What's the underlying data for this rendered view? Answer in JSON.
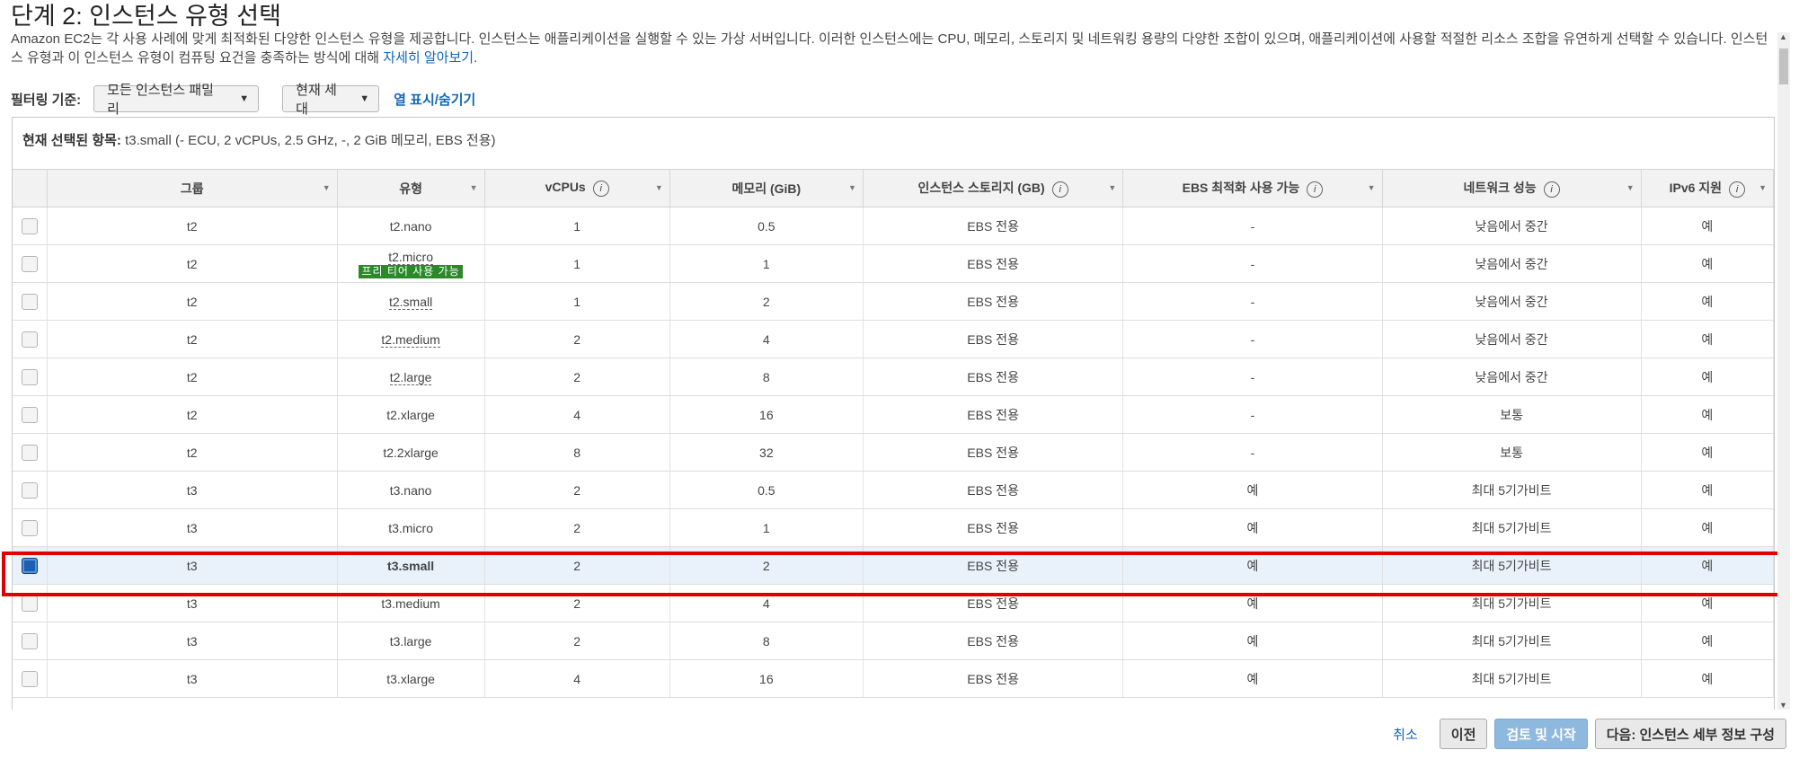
{
  "page": {
    "title": "단계 2: 인스턴스 유형 선택",
    "description": "Amazon EC2는 각 사용 사례에 맞게 최적화된 다양한 인스턴스 유형을 제공합니다. 인스턴스는 애플리케이션을 실행할 수 있는 가상 서버입니다. 이러한 인스턴스에는 CPU, 메모리, 스토리지 및 네트워킹 용량의 다양한 조합이 있으며, 애플리케이션에 사용할 적절한 리소스 조합을 유연하게 선택할 수 있습니다. 인스턴스 유형과 이 인스턴스 유형이 컴퓨팅 요건을 충족하는 방식에 대해 ",
    "learn_more": "자세히 알아보기",
    "description_end": "."
  },
  "filter": {
    "label": "필터링 기준:",
    "family": "모든 인스턴스 패밀리",
    "generation": "현재 세대",
    "column_toggle": "열 표시/숨기기"
  },
  "current": {
    "label": "현재 선택된 항목:",
    "value": " t3.small (- ECU, 2 vCPUs, 2.5 GHz, -, 2 GiB 메모리, EBS 전용)"
  },
  "table": {
    "headers": [
      "그룹",
      "유형",
      "vCPUs",
      "메모리 (GiB)",
      "인스턴스 스토리지 (GB)",
      "EBS 최적화 사용 가능",
      "네트워크 성능",
      "IPv6 지원"
    ],
    "free_tier_badge": "프리 티어 사용 가능",
    "rows": [
      {
        "group": "t2",
        "type": "t2.nano",
        "vcpus": "1",
        "mem": "0.5",
        "storage": "EBS 전용",
        "ebs": "-",
        "network": "낮음에서 중간",
        "ipv6": "예"
      },
      {
        "group": "t2",
        "type": "t2.micro",
        "vcpus": "1",
        "mem": "1",
        "storage": "EBS 전용",
        "ebs": "-",
        "network": "낮음에서 중간",
        "ipv6": "예"
      },
      {
        "group": "t2",
        "type": "t2.small",
        "vcpus": "1",
        "mem": "2",
        "storage": "EBS 전용",
        "ebs": "-",
        "network": "낮음에서 중간",
        "ipv6": "예"
      },
      {
        "group": "t2",
        "type": "t2.medium",
        "vcpus": "2",
        "mem": "4",
        "storage": "EBS 전용",
        "ebs": "-",
        "network": "낮음에서 중간",
        "ipv6": "예"
      },
      {
        "group": "t2",
        "type": "t2.large",
        "vcpus": "2",
        "mem": "8",
        "storage": "EBS 전용",
        "ebs": "-",
        "network": "낮음에서 중간",
        "ipv6": "예"
      },
      {
        "group": "t2",
        "type": "t2.xlarge",
        "vcpus": "4",
        "mem": "16",
        "storage": "EBS 전용",
        "ebs": "-",
        "network": "보통",
        "ipv6": "예"
      },
      {
        "group": "t2",
        "type": "t2.2xlarge",
        "vcpus": "8",
        "mem": "32",
        "storage": "EBS 전용",
        "ebs": "-",
        "network": "보통",
        "ipv6": "예"
      },
      {
        "group": "t3",
        "type": "t3.nano",
        "vcpus": "2",
        "mem": "0.5",
        "storage": "EBS 전용",
        "ebs": "예",
        "network": "최대 5기가비트",
        "ipv6": "예"
      },
      {
        "group": "t3",
        "type": "t3.micro",
        "vcpus": "2",
        "mem": "1",
        "storage": "EBS 전용",
        "ebs": "예",
        "network": "최대 5기가비트",
        "ipv6": "예"
      },
      {
        "group": "t3",
        "type": "t3.small",
        "vcpus": "2",
        "mem": "2",
        "storage": "EBS 전용",
        "ebs": "예",
        "network": "최대 5기가비트",
        "ipv6": "예"
      },
      {
        "group": "t3",
        "type": "t3.medium",
        "vcpus": "2",
        "mem": "4",
        "storage": "EBS 전용",
        "ebs": "예",
        "network": "최대 5기가비트",
        "ipv6": "예"
      },
      {
        "group": "t3",
        "type": "t3.large",
        "vcpus": "2",
        "mem": "8",
        "storage": "EBS 전용",
        "ebs": "예",
        "network": "최대 5기가비트",
        "ipv6": "예"
      },
      {
        "group": "t3",
        "type": "t3.xlarge",
        "vcpus": "4",
        "mem": "16",
        "storage": "EBS 전용",
        "ebs": "예",
        "network": "최대 5기가비트",
        "ipv6": "예"
      }
    ]
  },
  "footer": {
    "cancel": "취소",
    "prev": "이전",
    "review": "검토 및 시작",
    "next": "다음: 인스턴스 세부 정보 구성"
  },
  "colors": {
    "link": "#1166bb",
    "highlight": "#e00000",
    "free_tier": "#2a8a2a",
    "selected_row": "#e9f1fb",
    "primary_button": "#8fb8de"
  }
}
